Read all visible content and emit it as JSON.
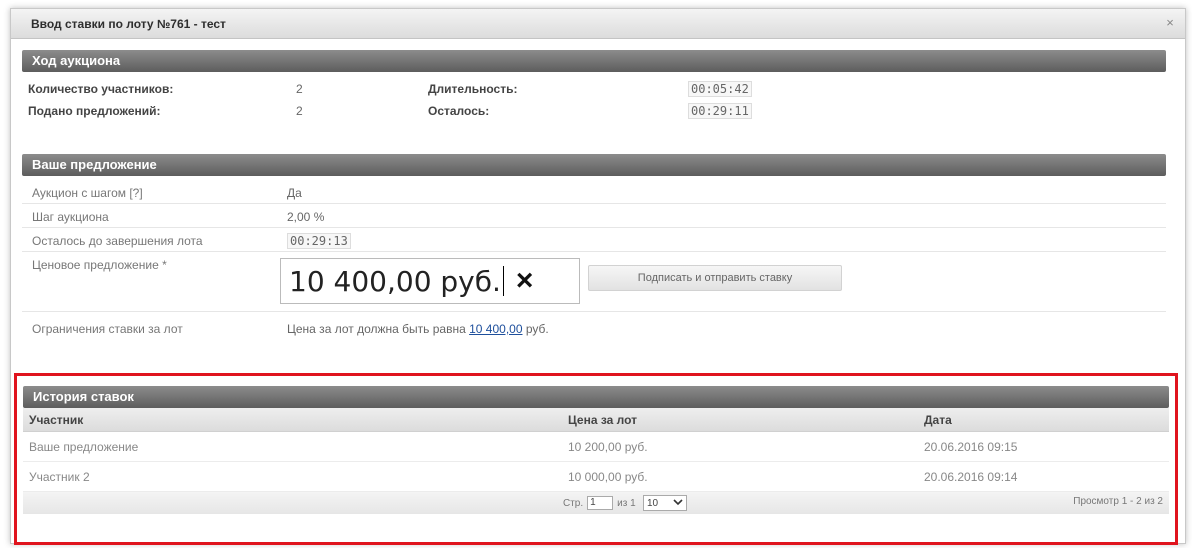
{
  "dialog": {
    "title": "Ввод ставки по лоту №761 - тест",
    "close_label": "×"
  },
  "progress": {
    "header": "Ход аукциона",
    "participants_label": "Количество участников:",
    "participants_value": "2",
    "offers_label": "Подано предложений:",
    "offers_value": "2",
    "duration_label": "Длительность:",
    "duration_value": "00:05:42",
    "remaining_label": "Осталось:",
    "remaining_value": "00:29:11"
  },
  "bid": {
    "header": "Ваше предложение",
    "step_auction_label": "Аукцион с шагом [?]",
    "step_auction_value": "Да",
    "step_label": "Шаг аукциона",
    "step_value": "2,00 %",
    "time_left_label": "Осталось до завершения лота",
    "time_left_value": "00:29:13",
    "price_label": "Ценовое предложение *",
    "price_value": "10 400,00 руб.",
    "clear_icon": "×",
    "sign_button": "Подписать и отправить ставку",
    "limit_label": "Ограничения ставки за лот",
    "limit_prefix": "Цена за лот должна быть равна",
    "limit_amount": "10 400,00",
    "limit_suffix": "руб."
  },
  "history": {
    "header": "История ставок",
    "columns": [
      "Участник",
      "Цена за лот",
      "Дата"
    ],
    "rows": [
      {
        "participant": "Ваше предложение",
        "price": "10 200,00 руб.",
        "date": "20.06.2016 09:15"
      },
      {
        "participant": "Участник 2",
        "price": "10 000,00 руб.",
        "date": "20.06.2016 09:14"
      }
    ],
    "pager": {
      "page_label": "Стр.",
      "page_value": "1",
      "of_label": "из 1",
      "per_page": "10",
      "view_text": "Просмотр 1 - 2 из 2"
    }
  }
}
